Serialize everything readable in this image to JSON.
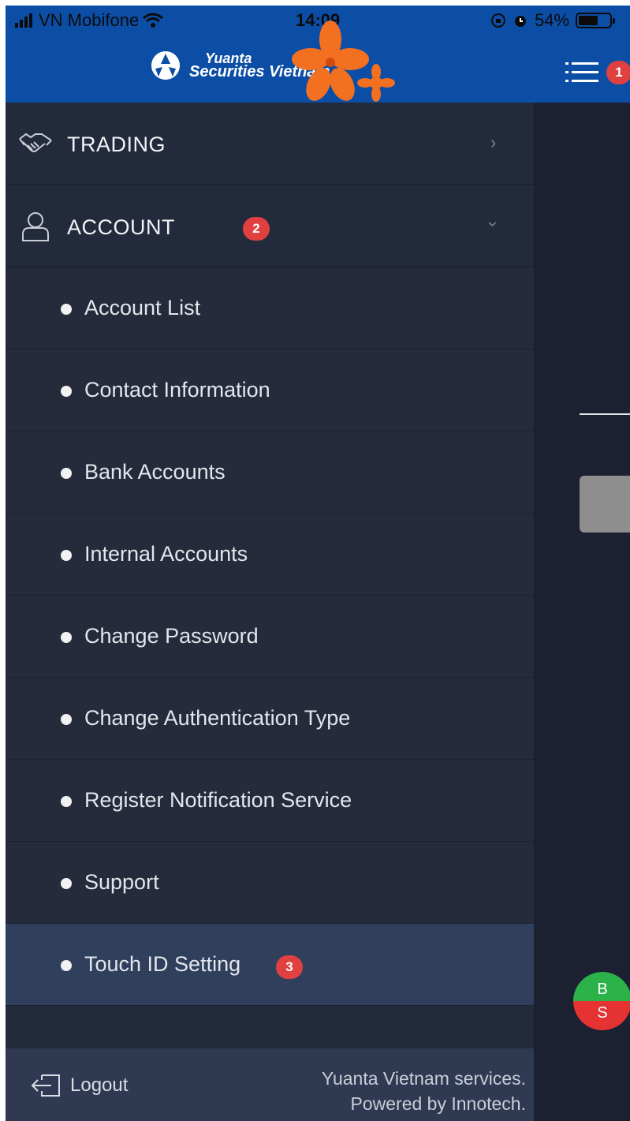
{
  "status_bar": {
    "carrier": "VN Mobifone",
    "time": "14:09",
    "battery": "54%"
  },
  "header": {
    "logo_line1": "Yuanta",
    "logo_line2": "Securities Vietnam",
    "menu_badge": "1"
  },
  "menu": {
    "trading_label": "TRADING",
    "account_label": "ACCOUNT",
    "account_badge": "2",
    "sub_items": [
      {
        "label": "Account List"
      },
      {
        "label": "Contact Information"
      },
      {
        "label": "Bank Accounts"
      },
      {
        "label": "Internal Accounts"
      },
      {
        "label": "Change Password"
      },
      {
        "label": "Change Authentication Type"
      },
      {
        "label": "Register Notification Service"
      },
      {
        "label": "Support"
      },
      {
        "label": "Touch ID Setting"
      }
    ],
    "touch_id_badge": "3"
  },
  "footer": {
    "logout_label": "Logout",
    "credits_line1": "Yuanta Vietnam services.",
    "credits_line2": "Powered by Innotech."
  },
  "quick_trade": {
    "buy_label": "B",
    "sell_label": "S"
  },
  "colors": {
    "header_blue": "#0c4ea6",
    "drawer_bg": "#232a3b",
    "active_item": "#303f5b",
    "badge_red": "#e0403f"
  }
}
